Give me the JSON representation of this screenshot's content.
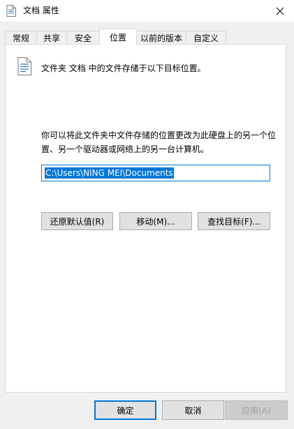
{
  "window": {
    "title": "文档 属性",
    "title_icon": "document-icon",
    "close_icon": "close-icon"
  },
  "tabs": [
    {
      "label": "常规",
      "active": false
    },
    {
      "label": "共享",
      "active": false
    },
    {
      "label": "安全",
      "active": false
    },
    {
      "label": "位置",
      "active": true
    },
    {
      "label": "以前的版本",
      "active": false
    },
    {
      "label": "自定义",
      "active": false
    }
  ],
  "location": {
    "description": "文件夹 文档 中的文件存储于以下目标位置。",
    "info": "你可以将此文件夹中文件存储的位置更改为此硬盘上的另一个位置、另一个驱动器或网络上的另一台计算机。",
    "path_value": "C:\\Users\\NING MEI\\Documents",
    "buttons": {
      "restore": "还原默认值(R)",
      "move": "移动(M)...",
      "find": "查找目标(F)..."
    }
  },
  "footer": {
    "ok": "确定",
    "cancel": "取消",
    "apply": "应用(A)"
  },
  "colors": {
    "accent": "#0078d7",
    "dialog_bg": "#f0f0f0",
    "button_bg": "#e1e1e1",
    "disabled_text": "#a0a0a0"
  }
}
